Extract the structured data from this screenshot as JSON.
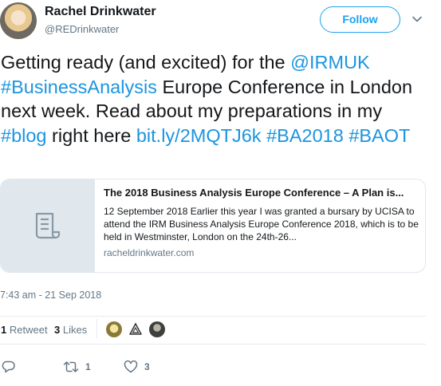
{
  "author": {
    "name": "Rachel Drinkwater",
    "handle": "@REDrinkwater",
    "follow_label": "Follow"
  },
  "tweet": {
    "text_parts": [
      {
        "t": "Getting ready (and excited) for the "
      },
      {
        "t": "@IRMUK",
        "link": true
      },
      {
        "t": " "
      },
      {
        "t": "#BusinessAnalysis",
        "link": true
      },
      {
        "t": " Europe  Conference in London next week. Read about my preparations in my "
      },
      {
        "t": "#blog",
        "link": true
      },
      {
        "t": " right here "
      },
      {
        "t": "bit.ly/2MQTJ6k",
        "link": true
      },
      {
        "t": " "
      },
      {
        "t": "#BA2018",
        "link": true
      },
      {
        "t": " "
      },
      {
        "t": "#BAOT",
        "link": true
      }
    ]
  },
  "card": {
    "title": "The 2018 Business Analysis Europe Conference – A Plan is...",
    "description": "12 September 2018 Earlier this year I was granted a bursary by UCISA to attend the IRM Business Analysis Europe Conference 2018, which is to be held in Westminster, London on the 24th-26...",
    "domain": "racheldrinkwater.com",
    "thumb_icon": "document-icon"
  },
  "timestamp": "7:43 am - 21 Sep 2018",
  "stats": {
    "retweets_count": "1",
    "retweets_label": "Retweet",
    "likes_count": "3",
    "likes_label": "Likes"
  },
  "actions": {
    "reply_icon": "reply-icon",
    "retweet_icon": "retweet-icon",
    "retweet_count": "1",
    "like_icon": "heart-icon",
    "like_count": "3"
  },
  "colors": {
    "accent": "#1da1f2",
    "link": "#1b95e0",
    "muted": "#657786"
  }
}
